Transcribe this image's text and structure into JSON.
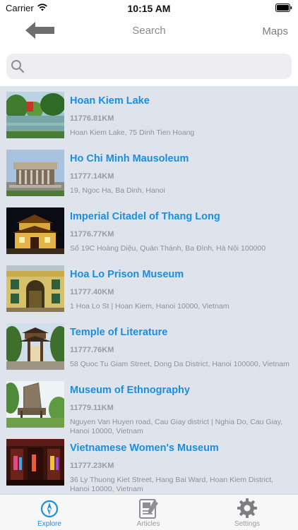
{
  "status_bar": {
    "carrier": "Carrier",
    "time": "10:15 AM"
  },
  "nav": {
    "title": "Search",
    "maps_label": "Maps"
  },
  "search": {
    "placeholder": "",
    "value": ""
  },
  "places": [
    {
      "name": "Hoan Kiem Lake",
      "distance": "11776.81KM",
      "address": "Hoan Kiem Lake, 75 Dinh Tien Hoang"
    },
    {
      "name": "Ho Chi Minh Mausoleum",
      "distance": "11777.14KM",
      "address": "19, Ngoc Ha,  Ba Dinh, Hanoi"
    },
    {
      "name": "Imperial Citadel of Thang Long",
      "distance": "11776.77KM",
      "address": "Số 19C Hoàng Diệu, Quán Thánh, Ba Đình, Hà Nội 100000"
    },
    {
      "name": "Hoa Lo Prison Museum",
      "distance": "11777.40KM",
      "address": "1 Hoa Lo St | Hoan Kiem, Hanoi 10000, Vietnam"
    },
    {
      "name": "Temple of Literature",
      "distance": "11777.76KM",
      "address": "58 Quoc Tu Giam Street, Dong Da District, Hanoi 100000, Vietnam"
    },
    {
      "name": "Museum of Ethnography",
      "distance": "11779.11KM",
      "address": "Nguyen Van Huyen road, Cau Giay district | Nghia Do, Cau Giay, Hanoi 10000, Vietnam"
    },
    {
      "name": "Vietnamese Women's Museum",
      "distance": "11777.23KM",
      "address": "36 Ly Thuong Kiet Street, Hang Bai Ward, Hoan Kiem District, Hanoi 10000, Vietnam"
    }
  ],
  "tabs": [
    {
      "label": "Explore",
      "icon": "compass-icon",
      "active": true
    },
    {
      "label": "Articles",
      "icon": "articles-icon",
      "active": false
    },
    {
      "label": "Settings",
      "icon": "gear-icon",
      "active": false
    }
  ],
  "colors": {
    "accent": "#1a8ee0",
    "list_background": "#dfe3ec"
  }
}
